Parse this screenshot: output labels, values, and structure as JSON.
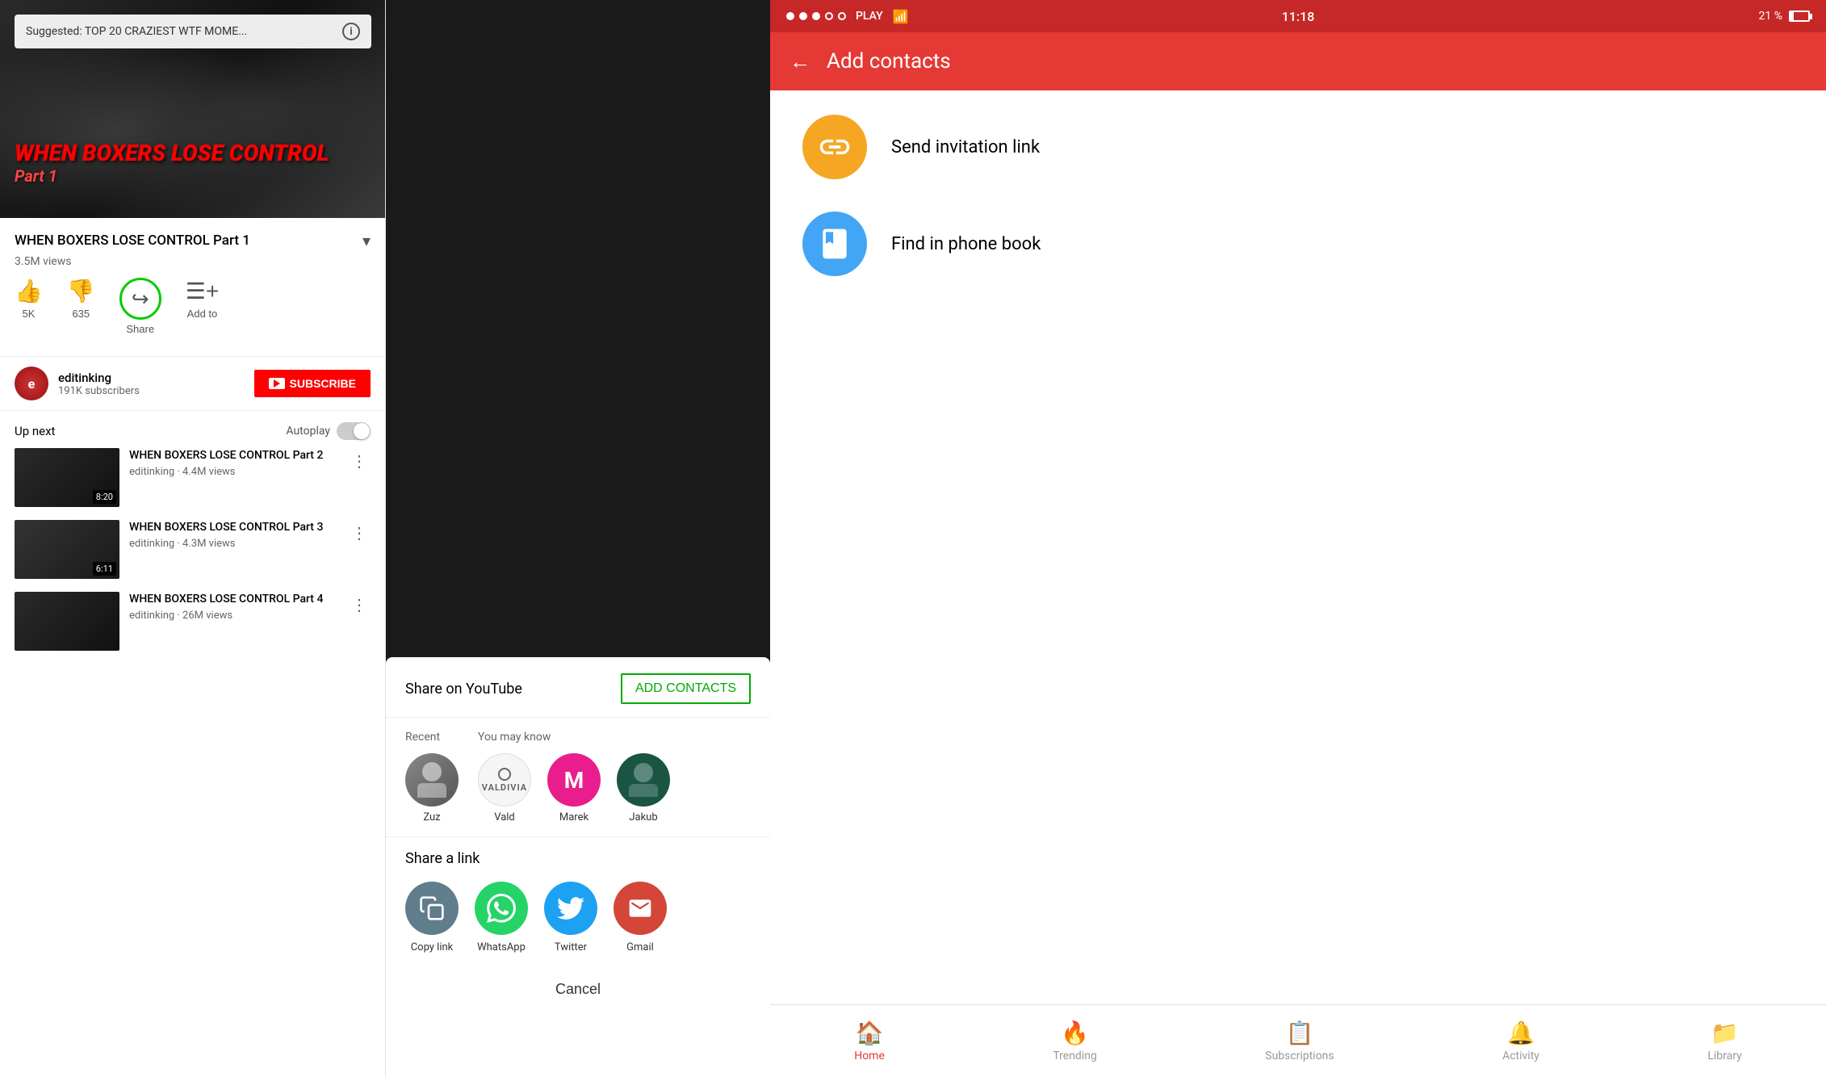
{
  "panel1": {
    "suggested_text": "Suggested: TOP 20 CRAZIEST WTF MOME...",
    "video_main_title_overlay": "WHEN BOXERS LOSE CONTROL",
    "video_subtitle_overlay": "Part 1",
    "video_title": "WHEN BOXERS LOSE CONTROL Part 1",
    "views": "3.5M views",
    "like_count": "5K",
    "dislike_count": "635",
    "share_label": "Share",
    "add_to_label": "Add to",
    "channel_name": "editinking",
    "channel_subs": "191K subscribers",
    "subscribe_label": "SUBSCRIBE",
    "up_next_label": "Up next",
    "autoplay_label": "Autoplay",
    "videos": [
      {
        "title": "WHEN BOXERS LOSE CONTROL Part 2",
        "channel": "editinking",
        "views": "4.4M views",
        "duration": "8:20"
      },
      {
        "title": "WHEN BOXERS LOSE CONTROL Part 3",
        "channel": "editinking",
        "views": "4.3M views",
        "duration": "6:11"
      },
      {
        "title": "WHEN BOXERS LOSE CONTROL Part 4",
        "channel": "editinking",
        "views": "26M views",
        "duration": ""
      }
    ]
  },
  "panel2": {
    "share_on_youtube_label": "Share on YouTube",
    "add_contacts_label": "ADD CONTACTS",
    "recent_label": "Recent",
    "you_may_know_label": "You may know",
    "contact_zuz": "Zuz",
    "contact_vald": "Vald",
    "contact_marek": "Marek",
    "contact_jakub": "Jakub",
    "share_link_label": "Share a link",
    "copy_link_label": "Copy link",
    "whatsapp_label": "WhatsApp",
    "twitter_label": "Twitter",
    "gmail_label": "Gmail",
    "cancel_label": "Cancel"
  },
  "panel3": {
    "status_bar": {
      "dots": [
        "filled",
        "filled",
        "filled",
        "outline",
        "outline"
      ],
      "carrier": "PLAY",
      "time": "11:18",
      "battery_pct": "21 %"
    },
    "header_title": "Add contacts",
    "back_arrow": "←",
    "option1_label": "Send invitation link",
    "option2_label": "Find in phone book",
    "nav_items": [
      {
        "label": "Home",
        "active": true
      },
      {
        "label": "Trending",
        "active": false
      },
      {
        "label": "Subscriptions",
        "active": false
      },
      {
        "label": "Activity",
        "active": false
      },
      {
        "label": "Library",
        "active": false
      }
    ]
  }
}
